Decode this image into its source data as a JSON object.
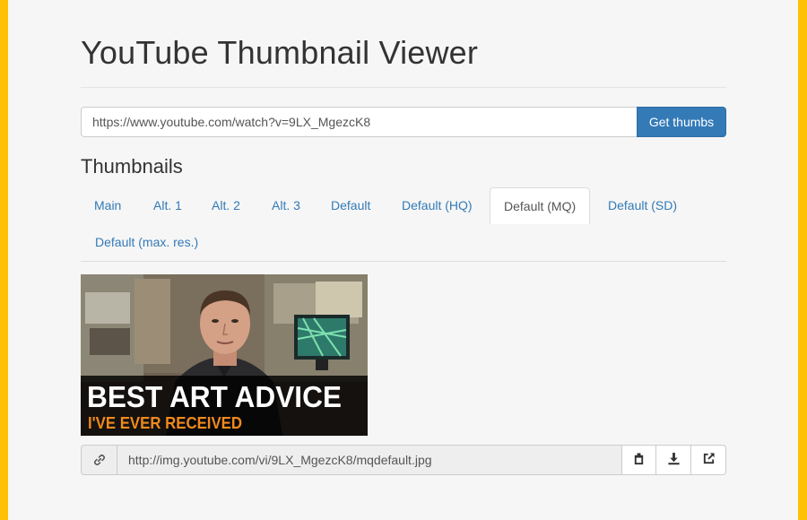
{
  "header": {
    "title": "YouTube Thumbnail Viewer"
  },
  "url_form": {
    "url_value": "https://www.youtube.com/watch?v=9LX_MgezcK8",
    "submit_label": "Get thumbs"
  },
  "thumbnails": {
    "heading": "Thumbnails",
    "tabs": [
      {
        "label": "Main"
      },
      {
        "label": "Alt. 1"
      },
      {
        "label": "Alt. 2"
      },
      {
        "label": "Alt. 3"
      },
      {
        "label": "Default"
      },
      {
        "label": "Default (HQ)"
      },
      {
        "label": "Default (MQ)",
        "active": true
      },
      {
        "label": "Default (SD)"
      },
      {
        "label": "Default (max. res.)"
      }
    ],
    "image": {
      "caption_line1": "BEST ART ADVICE",
      "caption_line2": "I'VE EVER RECEIVED"
    },
    "image_url": "http://img.youtube.com/vi/9LX_MgezcK8/mqdefault.jpg",
    "action_icons": [
      "link-icon",
      "copy-icon",
      "download-icon",
      "external-link-icon"
    ]
  },
  "colors": {
    "frame": "#ffc107",
    "primary": "#337ab7",
    "caption_orange": "#f08a1c"
  }
}
